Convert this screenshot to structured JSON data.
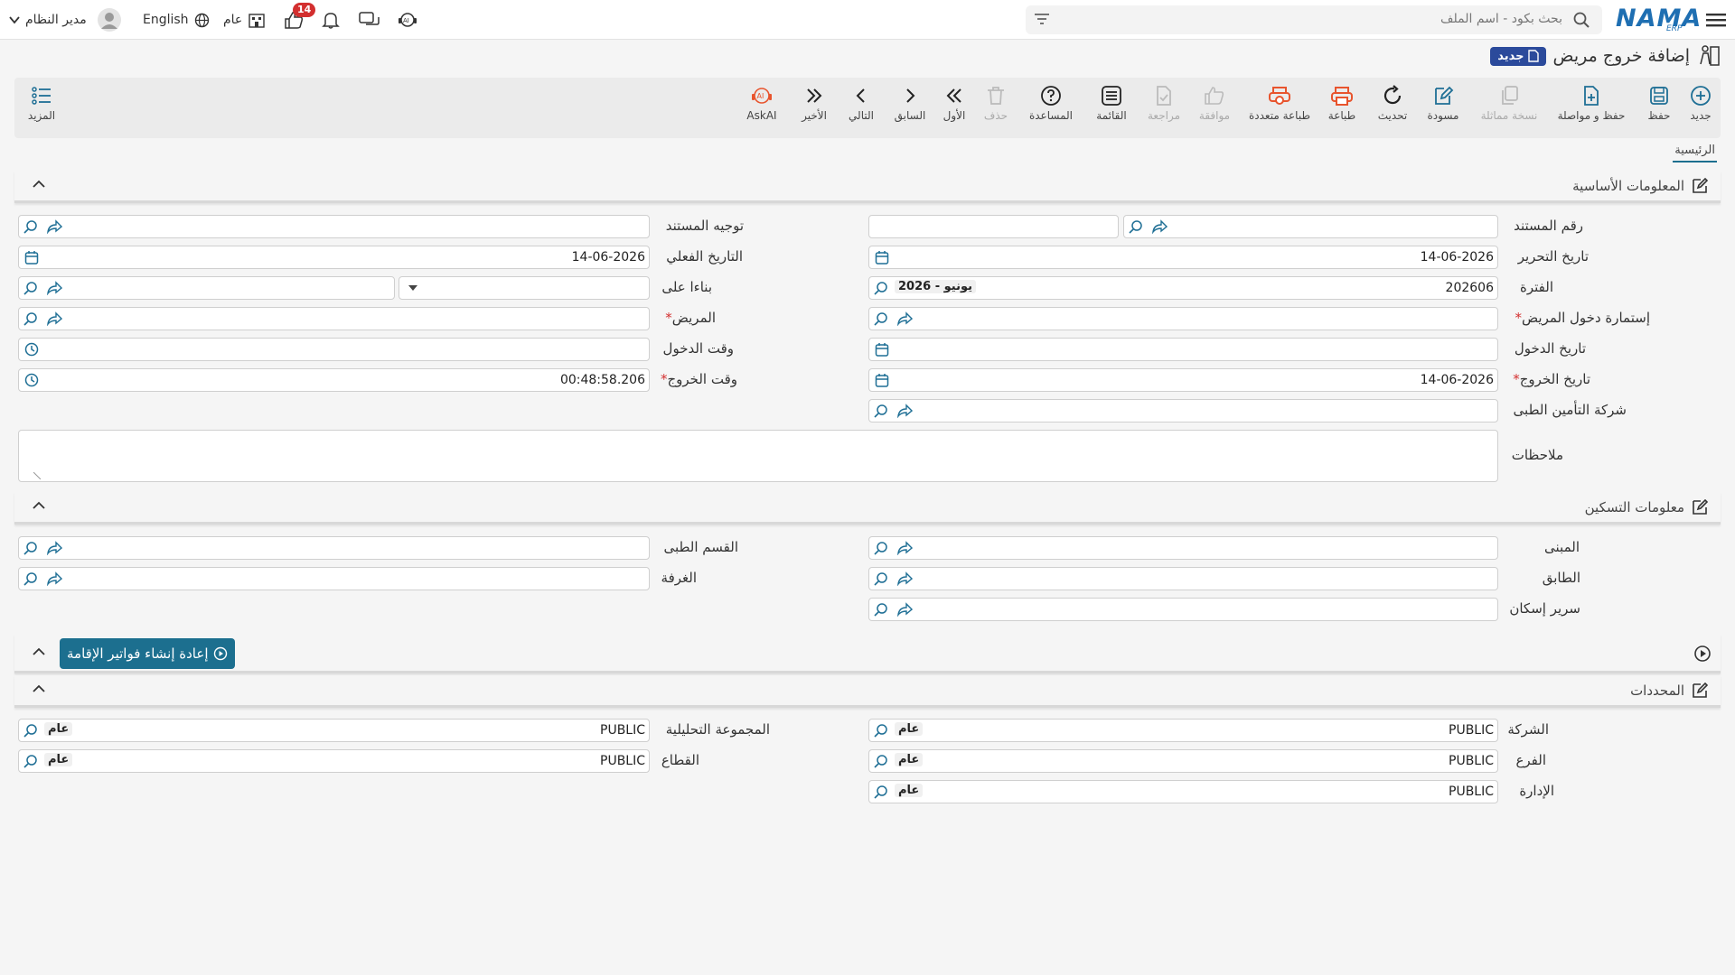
{
  "header": {
    "search_placeholder": "بحث بكود - اسم الملف",
    "notif_count": "14",
    "lang_label": "English",
    "scope_label": "عام",
    "user_label": "مدير النظام",
    "brand": "NAMA",
    "brand_sub": "ERP"
  },
  "page": {
    "title": "إضافة خروج مريض",
    "new_badge": "جديد"
  },
  "toolbar": {
    "new": "جديد",
    "save": "حفظ",
    "save_continue": "حفظ و مواصلة",
    "copy": "نسخة مماثلة",
    "draft": "مسودة",
    "refresh": "تحديث",
    "print": "طباعة",
    "multi_print": "طباعة متعددة",
    "approve": "موافقة",
    "review": "مراجعة",
    "list": "القائمة",
    "help": "المساعدة",
    "delete": "حذف",
    "first": "الأول",
    "prev": "السابق",
    "next": "التالي",
    "last": "الأخير",
    "askai": "AskAI",
    "more": "المزيد"
  },
  "tabs": {
    "main": "الرئيسية"
  },
  "sections": {
    "basic": "المعلومات الأساسية",
    "housing": "معلومات التسكين",
    "rebuild_button": "إعادة إنشاء فواتير الإقامة",
    "dimensions": "المحددات"
  },
  "fields": {
    "doc_no": "رقم المستند",
    "doc_direction": "توجيه المستند",
    "edit_date": "تاريخ التحرير",
    "edit_date_val": "14-06-2026",
    "actual_date": "التاريخ الفعلي",
    "actual_date_val": "14-06-2026",
    "period": "الفترة",
    "period_val": "202606",
    "period_chip": "2026 - يونيو",
    "based_on": "بناءا على",
    "admission_form": "إستمارة دخول المريض",
    "patient": "المريض",
    "entry_date": "تاريخ الدخول",
    "entry_time": "وقت الدخول",
    "exit_date": "تاريخ الخروج",
    "exit_date_val": "14-06-2026",
    "exit_time": "وقت الخروج",
    "exit_time_val": "00:48:58.206",
    "insurance": "شركة التأمين الطبى",
    "notes": "ملاحظات",
    "building": "المبنى",
    "medical_dept": "القسم الطبى",
    "floor": "الطابق",
    "room": "الغرفة",
    "bed": "سرير إسكان",
    "company": "الشركة",
    "analytic_group": "المجموعة التحليلية",
    "branch": "الفرع",
    "sector": "القطاع",
    "department": "الإدارة",
    "public_val": "PUBLIC",
    "general_chip": "عام"
  },
  "colors": {
    "accent": "#1c6f8f",
    "brand": "#2b4a9b",
    "badge": "#d32f2f",
    "print": "#e8542d"
  }
}
